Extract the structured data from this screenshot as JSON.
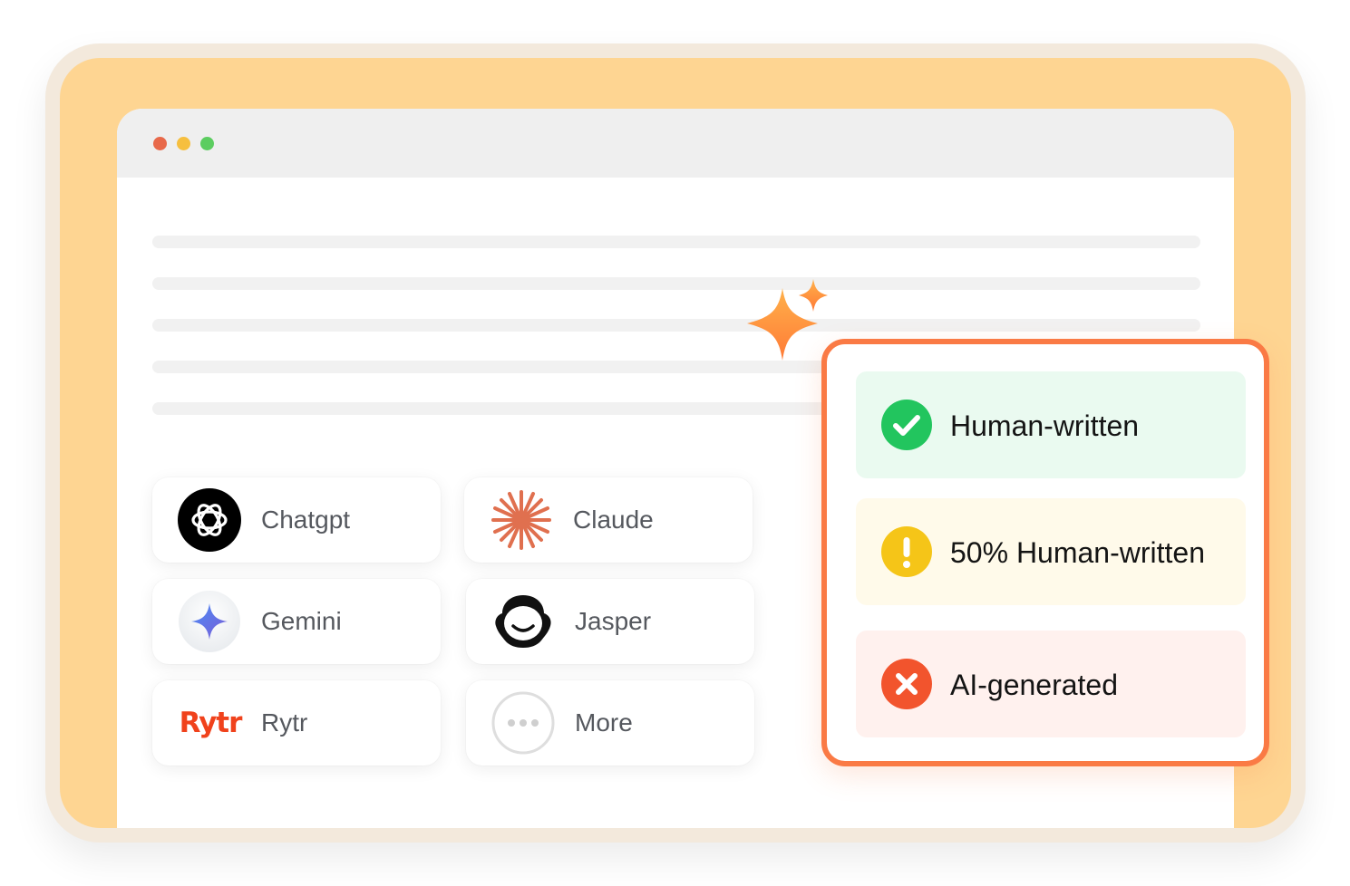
{
  "window": {
    "buttons": [
      "close",
      "minimize",
      "maximize"
    ],
    "colors": {
      "close": "#e8694a",
      "minimize": "#f6bf3f",
      "maximize": "#5ccd60"
    }
  },
  "ai_sources": [
    {
      "label": "Chatgpt",
      "icon": "chatgpt-logo-icon"
    },
    {
      "label": "Claude",
      "icon": "claude-starburst-icon"
    },
    {
      "label": "Gemini",
      "icon": "gemini-sparkle-icon"
    },
    {
      "label": "Jasper",
      "icon": "jasper-face-icon"
    },
    {
      "label": "Rytr",
      "icon": "rytr-logo-icon",
      "logo_text": "Rytr"
    },
    {
      "label": "More",
      "icon": "more-dots-icon"
    }
  ],
  "results": [
    {
      "label": "Human-written",
      "icon": "check-icon",
      "color": "#22c55e",
      "bg": "#eafaf0"
    },
    {
      "label": "50% Human-written",
      "icon": "warning-icon",
      "color": "#f5c518",
      "bg": "#fffaea"
    },
    {
      "label": "AI-generated",
      "icon": "x-icon",
      "color": "#f2542d",
      "bg": "#fff1ee"
    }
  ],
  "accent": {
    "panel_border": "#fa7a45",
    "background": "#fed592"
  }
}
